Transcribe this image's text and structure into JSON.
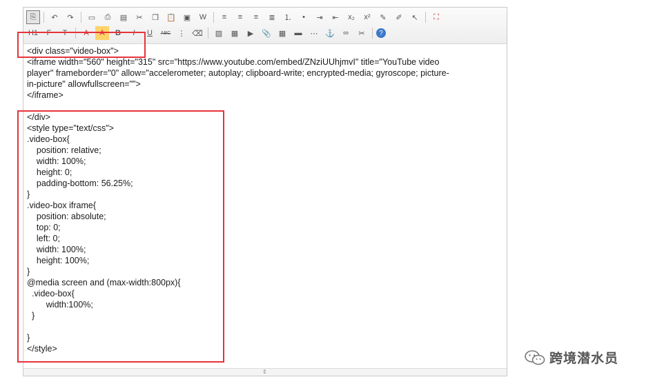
{
  "toolbar": {
    "row1": [
      {
        "name": "source-toggle-icon",
        "glyph": "⎘",
        "pressed": true
      },
      {
        "sep": true
      },
      {
        "name": "undo-icon",
        "glyph": "↶"
      },
      {
        "name": "redo-icon",
        "glyph": "↷"
      },
      {
        "sep": true
      },
      {
        "name": "preview-icon",
        "glyph": "▭"
      },
      {
        "name": "print-icon",
        "glyph": "⎙"
      },
      {
        "name": "code-icon",
        "glyph": "▤"
      },
      {
        "name": "cut-icon",
        "glyph": "✂"
      },
      {
        "name": "copy-icon",
        "glyph": "❐"
      },
      {
        "name": "paste-icon",
        "glyph": "📋"
      },
      {
        "name": "paste-text-icon",
        "glyph": "▣"
      },
      {
        "name": "paste-word-icon",
        "glyph": "W"
      },
      {
        "sep": true
      },
      {
        "name": "align-left-icon",
        "glyph": "≡"
      },
      {
        "name": "align-center-icon",
        "glyph": "≡"
      },
      {
        "name": "align-right-icon",
        "glyph": "≡"
      },
      {
        "name": "justify-icon",
        "glyph": "≣"
      },
      {
        "name": "ordered-list-icon",
        "glyph": "⒈"
      },
      {
        "name": "unordered-list-icon",
        "glyph": "•"
      },
      {
        "name": "indent-icon",
        "glyph": "⇥"
      },
      {
        "name": "outdent-icon",
        "glyph": "⇤"
      },
      {
        "name": "subscript-icon",
        "glyph": "x₂"
      },
      {
        "name": "superscript-icon",
        "glyph": "x²"
      },
      {
        "name": "clear-format-brush-icon",
        "glyph": "✎"
      },
      {
        "name": "format-painter-icon",
        "glyph": "✐"
      },
      {
        "name": "select-all-icon",
        "glyph": "↖"
      },
      {
        "sep": true
      },
      {
        "name": "fullscreen-icon",
        "glyph": "⛶"
      }
    ],
    "row2": [
      {
        "name": "heading-icon",
        "glyph": "H1"
      },
      {
        "name": "font-family-icon",
        "glyph": "F"
      },
      {
        "name": "font-size-icon",
        "glyph": "T"
      },
      {
        "sep": true
      },
      {
        "name": "text-color-icon",
        "glyph": "A"
      },
      {
        "name": "highlight-color-icon",
        "glyph": "A"
      },
      {
        "name": "bold-icon",
        "glyph": "B"
      },
      {
        "name": "italic-icon",
        "glyph": "I"
      },
      {
        "name": "underline-icon",
        "glyph": "U"
      },
      {
        "name": "strikethrough-icon",
        "glyph": "ABC"
      },
      {
        "name": "line-height-icon",
        "glyph": "⋮"
      },
      {
        "name": "eraser-icon",
        "glyph": "⌫"
      },
      {
        "sep": true
      },
      {
        "name": "image-icon",
        "glyph": "▨"
      },
      {
        "name": "multi-image-icon",
        "glyph": "▦"
      },
      {
        "name": "video-icon",
        "glyph": "▶"
      },
      {
        "name": "attachment-icon",
        "glyph": "📎"
      },
      {
        "name": "table-icon",
        "glyph": "▦"
      },
      {
        "name": "hr-icon",
        "glyph": "▬"
      },
      {
        "name": "page-break-icon",
        "glyph": "⋯"
      },
      {
        "name": "anchor-icon",
        "glyph": "⚓"
      },
      {
        "name": "link-icon",
        "glyph": "∞"
      },
      {
        "name": "unlink-icon",
        "glyph": "✂"
      },
      {
        "sep": true
      },
      {
        "name": "help-icon",
        "glyph": "?"
      }
    ]
  },
  "code_lines": [
    "<div class=\"video-box\">",
    "<iframe width=\"560\" height=\"315\" src=\"https://www.youtube.com/embed/ZNziUUhjmvI\" title=\"YouTube video",
    "player\" frameborder=\"0\" allow=\"accelerometer; autoplay; clipboard-write; encrypted-media; gyroscope; picture-",
    "in-picture\" allowfullscreen=\"\">",
    "</iframe>",
    "",
    "</div>",
    "<style type=\"text/css\">",
    ".video-box{",
    "    position: relative;",
    "    width: 100%;",
    "    height: 0;",
    "    padding-bottom: 56.25%;",
    "}",
    ".video-box iframe{",
    "    position: absolute;",
    "    top: 0;",
    "    left: 0;",
    "    width: 100%;",
    "    height: 100%;",
    "}",
    "@media screen and (max-width:800px){",
    "  .video-box{",
    "        width:100%;",
    "  }",
    "",
    "}",
    "</style>"
  ],
  "watermark": {
    "text": "跨境潜水员"
  },
  "colors": {
    "highlight_red": "#e5333a"
  }
}
